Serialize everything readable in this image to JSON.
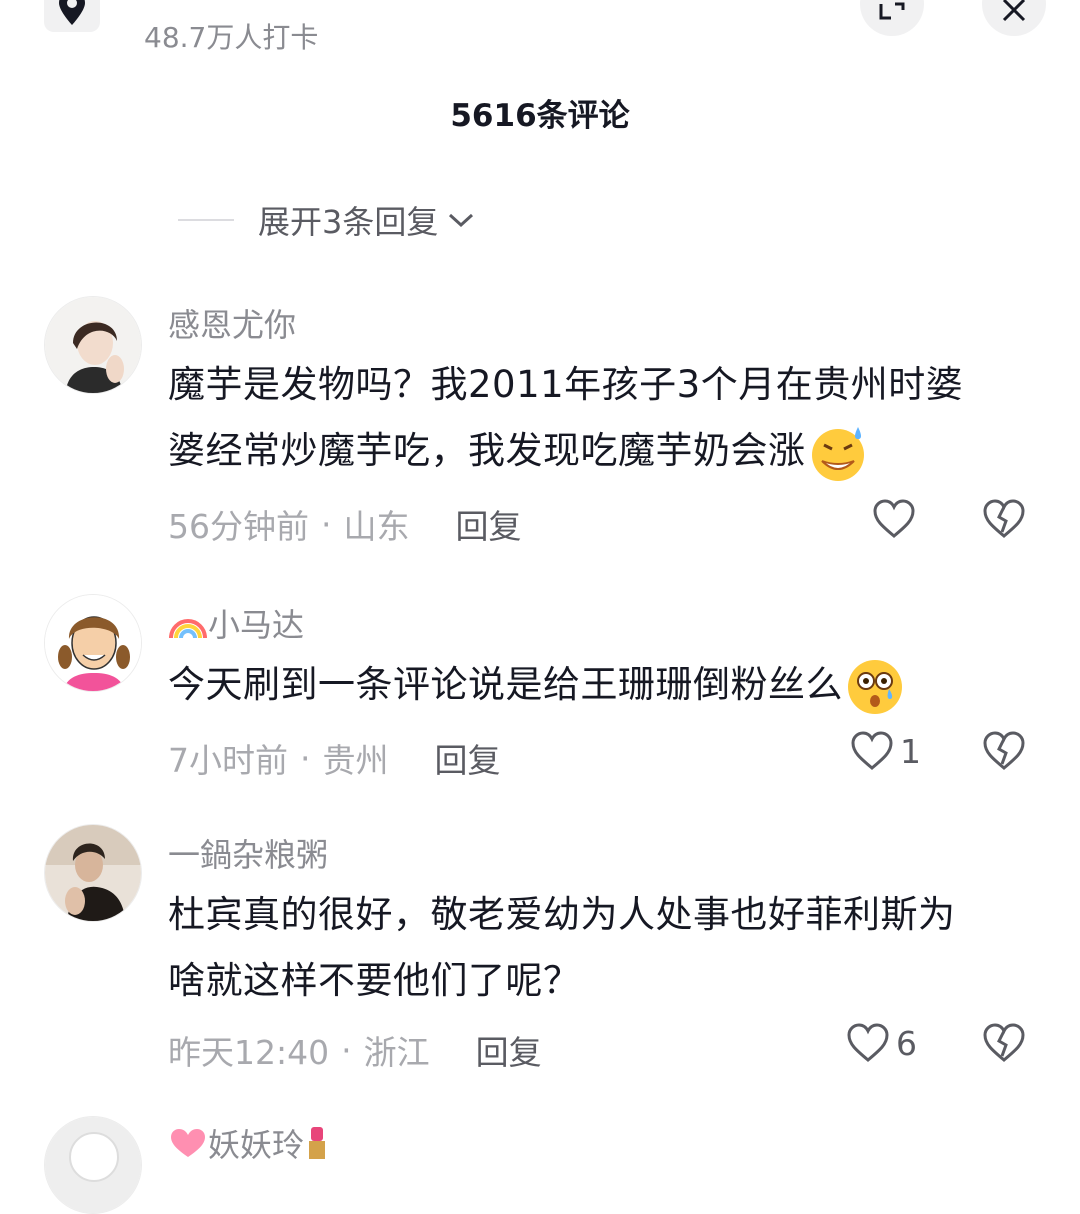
{
  "location": {
    "count_text": "48.7万人打卡",
    "icon": "location-pin-icon"
  },
  "comment_count": "5616条评论",
  "expand_replies": {
    "label": "展开3条回复"
  },
  "comments": [
    {
      "username": "感恩尤你",
      "text_line1": "魔芋是发物吗？我2011年孩子3个月在贵州时婆",
      "text_line2": "婆经常炒魔芋吃，我发现吃魔芋奶会涨",
      "time": "56分钟前",
      "region": "山东",
      "reply": "回复",
      "likes": ""
    },
    {
      "username": "小马达",
      "text_line1": "今天刷到一条评论说是给王珊珊倒粉丝么",
      "time": "7小时前",
      "region": "贵州",
      "reply": "回复",
      "likes": "1"
    },
    {
      "username": "一鍋杂粮粥",
      "text_line1": "杜宾真的很好，敬老爱幼为人处事也好菲利斯为",
      "text_line2": "啥就这样不要他们了呢？",
      "time": "昨天12:40",
      "region": "浙江",
      "reply": "回复",
      "likes": "6"
    },
    {
      "username": "妖妖玲"
    }
  ],
  "separator": "·",
  "colors": {
    "text_primary": "#161823",
    "text_secondary": "#8a8b91",
    "meta": "#a8a9ae"
  }
}
